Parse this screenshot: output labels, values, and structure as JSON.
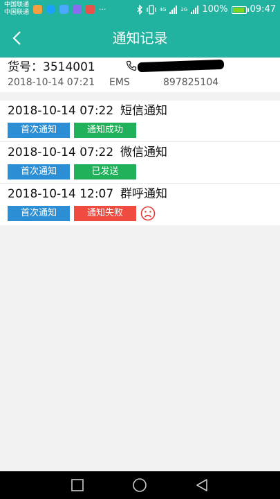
{
  "status_bar": {
    "carrier_1": "中国联通",
    "carrier_2": "中国联通",
    "overflow": "···",
    "net_4g": "4G",
    "net_2g": "2G",
    "battery_text": "100%",
    "time": "09:47"
  },
  "header": {
    "title": "通知记录"
  },
  "order": {
    "number_text": "货号：3514001",
    "datetime": "2018-10-14 07:21",
    "carrier": "EMS",
    "tracking_no": "897825104"
  },
  "records": [
    {
      "time": "2018-10-14 07:22",
      "type": "短信通知",
      "tag": "首次通知",
      "status": "通知成功",
      "status_color": "#20b15a"
    },
    {
      "time": "2018-10-14 07:22",
      "type": "微信通知",
      "tag": "首次通知",
      "status": "已发送",
      "status_color": "#20b15a"
    },
    {
      "time": "2018-10-14 12:07",
      "type": "群呼通知",
      "tag": "首次通知",
      "status": "通知失败",
      "status_color": "#ef4b3f"
    }
  ],
  "colors": {
    "accent": "#22b2a0",
    "tag_blue": "#2c8fd6",
    "success": "#20b15a",
    "fail": "#ef4b3f"
  },
  "icons": {
    "back": "chevron-left-icon",
    "phone": "phone-icon",
    "failure": "sad-face-icon"
  }
}
